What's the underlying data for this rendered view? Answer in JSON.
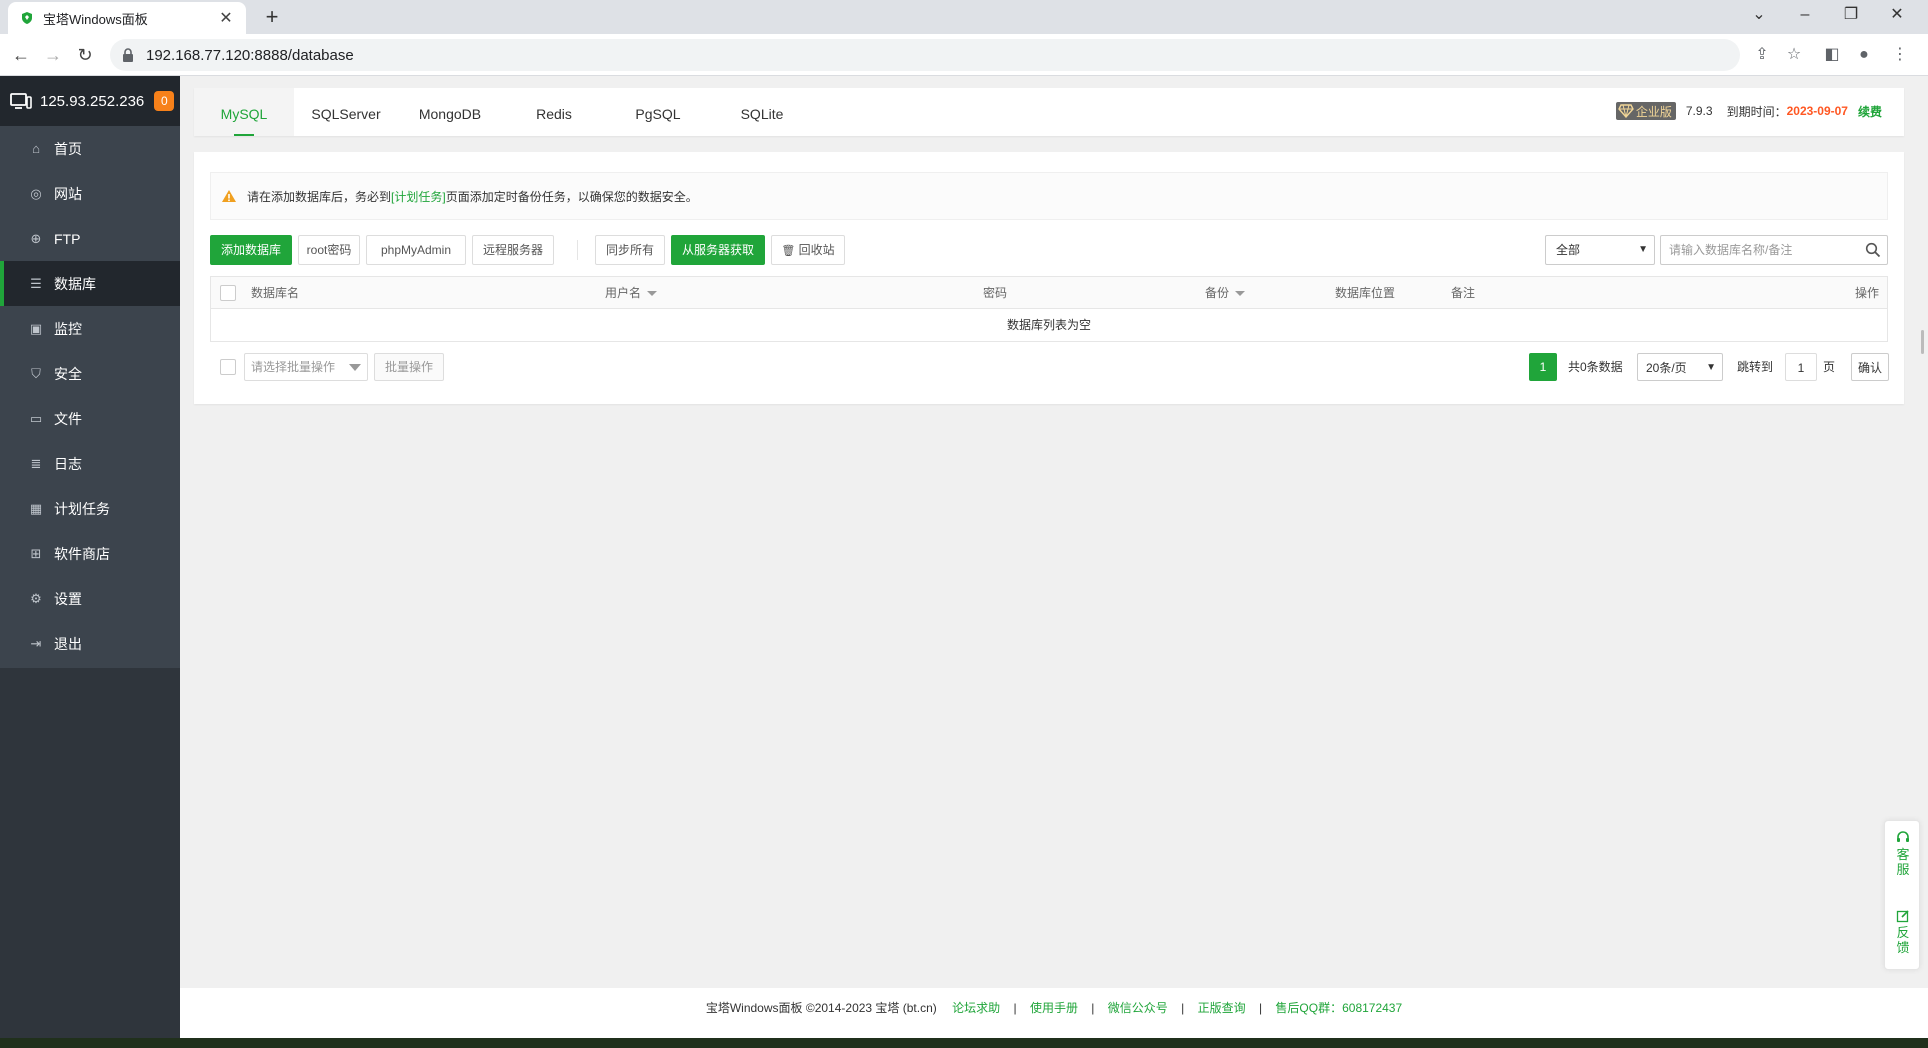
{
  "browser": {
    "tab_title": "宝塔Windows面板",
    "tab_close": "✕",
    "new_tab": "+",
    "url": "192.168.77.120:8888/database"
  },
  "sidebar": {
    "server_ip": "125.93.252.236",
    "badge_count": "0",
    "items": [
      {
        "label": "首页",
        "icon": "home-icon"
      },
      {
        "label": "网站",
        "icon": "globe-icon"
      },
      {
        "label": "FTP",
        "icon": "ftp-icon"
      },
      {
        "label": "数据库",
        "icon": "database-icon",
        "active": true
      },
      {
        "label": "监控",
        "icon": "monitor-chart-icon"
      },
      {
        "label": "安全",
        "icon": "shield-icon"
      },
      {
        "label": "文件",
        "icon": "folder-icon"
      },
      {
        "label": "日志",
        "icon": "log-icon"
      },
      {
        "label": "计划任务",
        "icon": "calendar-icon"
      },
      {
        "label": "软件商店",
        "icon": "apps-icon"
      },
      {
        "label": "设置",
        "icon": "gear-icon"
      },
      {
        "label": "退出",
        "icon": "logout-icon"
      }
    ]
  },
  "topnav": {
    "tabs": [
      "MySQL",
      "SQLServer",
      "MongoDB",
      "Redis",
      "PgSQL",
      "SQLite"
    ],
    "active_tab": "MySQL",
    "edition": "企业版",
    "version": "7.9.3",
    "expire_label": "到期时间：",
    "expire_date": "2023-09-07",
    "renew": "续费"
  },
  "notice": {
    "before": "请在添加数据库后，务必到",
    "link": "[计划任务]",
    "after": "页面添加定时备份任务，以确保您的数据安全。"
  },
  "toolbar": {
    "add_db": "添加数据库",
    "root_pwd": "root密码",
    "phpmyadmin": "phpMyAdmin",
    "remote": "远程服务器",
    "sync_all": "同步所有",
    "fetch": "从服务器获取",
    "recycle": "回收站",
    "filter_value": "全部",
    "search_placeholder": "请输入数据库名称/备注"
  },
  "table": {
    "headers": {
      "name": "数据库名",
      "user": "用户名",
      "password": "密码",
      "backup": "备份",
      "location": "数据库位置",
      "note": "备注",
      "action": "操作"
    },
    "empty": "数据库列表为空"
  },
  "batch": {
    "placeholder": "请选择批量操作",
    "button": "批量操作"
  },
  "pager": {
    "current": "1",
    "total": "共0条数据",
    "page_size": "20条/页",
    "jump": "跳转到",
    "page_input": "1",
    "page_unit": "页",
    "confirm": "确认"
  },
  "footer": {
    "copyright": "宝塔Windows面板 ©2014-2023 宝塔 (bt.cn)",
    "links": [
      "论坛求助",
      "使用手册",
      "微信公众号",
      "正版查询",
      "售后QQ群：608172437"
    ]
  },
  "float_panel": {
    "service": "客服",
    "feedback": "反馈"
  },
  "colors": {
    "accent": "#20a53a",
    "sidebar": "#3c444d",
    "sidebar_dark": "#22272d",
    "badge": "#f7811a",
    "expire": "#ff5722"
  }
}
